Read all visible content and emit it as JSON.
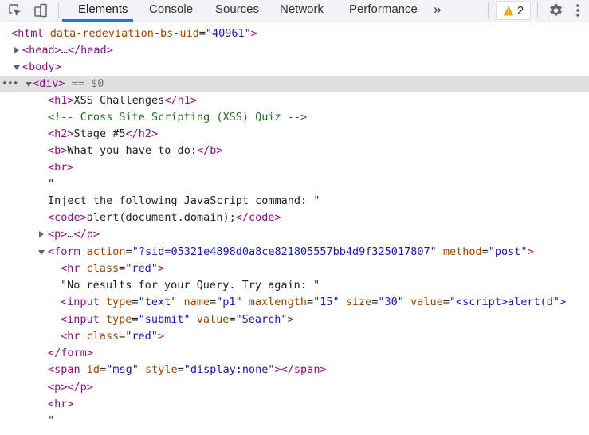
{
  "toolbar": {
    "tabs": [
      {
        "label": "Elements",
        "active": true
      },
      {
        "label": "Console",
        "active": false
      },
      {
        "label": "Sources",
        "active": false
      },
      {
        "label": "Network",
        "active": false
      },
      {
        "label": "Performance",
        "active": false
      }
    ],
    "more_glyph": "»",
    "warning_count": "2",
    "icons": [
      "inspect-element-icon",
      "device-toolbar-icon",
      "warning-icon",
      "settings-gear-icon",
      "more-options-icon"
    ]
  },
  "colors": {
    "tag": "#881280",
    "attribute_name": "#994500",
    "attribute_value": "#1a1aa6",
    "comment": "#236e25",
    "selected_row": "#e0e0e0",
    "active_tab_underline": "#1a73e8"
  },
  "dom_tree": {
    "html_open": "<html ",
    "html_attr": "data-redeviation-bs-uid",
    "html_attr_value": "\"40961\"",
    "gt": ">",
    "head_open": "<head>",
    "ellipsis": "…",
    "head_close": "</head>",
    "body_open": "<body>",
    "div_open": "<div>",
    "selected_marker": " == $0",
    "h1_open": "<h1>",
    "h1_text": "XSS Challenges",
    "h1_close": "</h1>",
    "comment": "<!-- Cross Site Scripting (XSS) Quiz -->",
    "h2_open": "<h2>",
    "h2_text": "Stage #5",
    "h2_close": "</h2>",
    "b_open": "<b>",
    "b_text": "What you have to do:",
    "b_close": "</b>",
    "br": "<br>",
    "quote": "\"",
    "inject_text": "Inject the following JavaScript command: \"",
    "code_open": "<code>",
    "code_text": "alert(document.domain);",
    "code_close": "</code>",
    "p_open": "<p>",
    "p_close": "</p>",
    "form_open": "<form ",
    "form_action_attr": "action",
    "form_action_value": "\"?sid=05321e4898d0a8ce821805557bb4d9f325017807\"",
    "form_method_attr": "method",
    "form_method_value": "\"post\"",
    "hr_open": "<hr ",
    "class_attr": "class",
    "class_value": "\"red\"",
    "no_results_text": "\"No results for your Query. Try again: \"",
    "input_open": "<input ",
    "type_attr": "type",
    "type_text_value": "\"text\"",
    "name_attr": "name",
    "name_value": "\"p1\"",
    "maxlength_attr": "maxlength",
    "maxlength_value": "\"15\"",
    "size_attr": "size",
    "size_value": "\"30\"",
    "value_attr": "value",
    "value_text_value": "\"<script>alert(d\">",
    "type_submit_value": "\"submit\"",
    "value_search_value": "\"Search\"",
    "form_close": "</form>",
    "span_open": "<span ",
    "id_attr": "id",
    "id_value": "\"msg\"",
    "style_attr": "style",
    "style_value": "\"display:none\"",
    "span_close": "></span>",
    "p_empty": "<p></p>",
    "hr_tag": "<hr>",
    "equals": "=",
    "space": " "
  }
}
